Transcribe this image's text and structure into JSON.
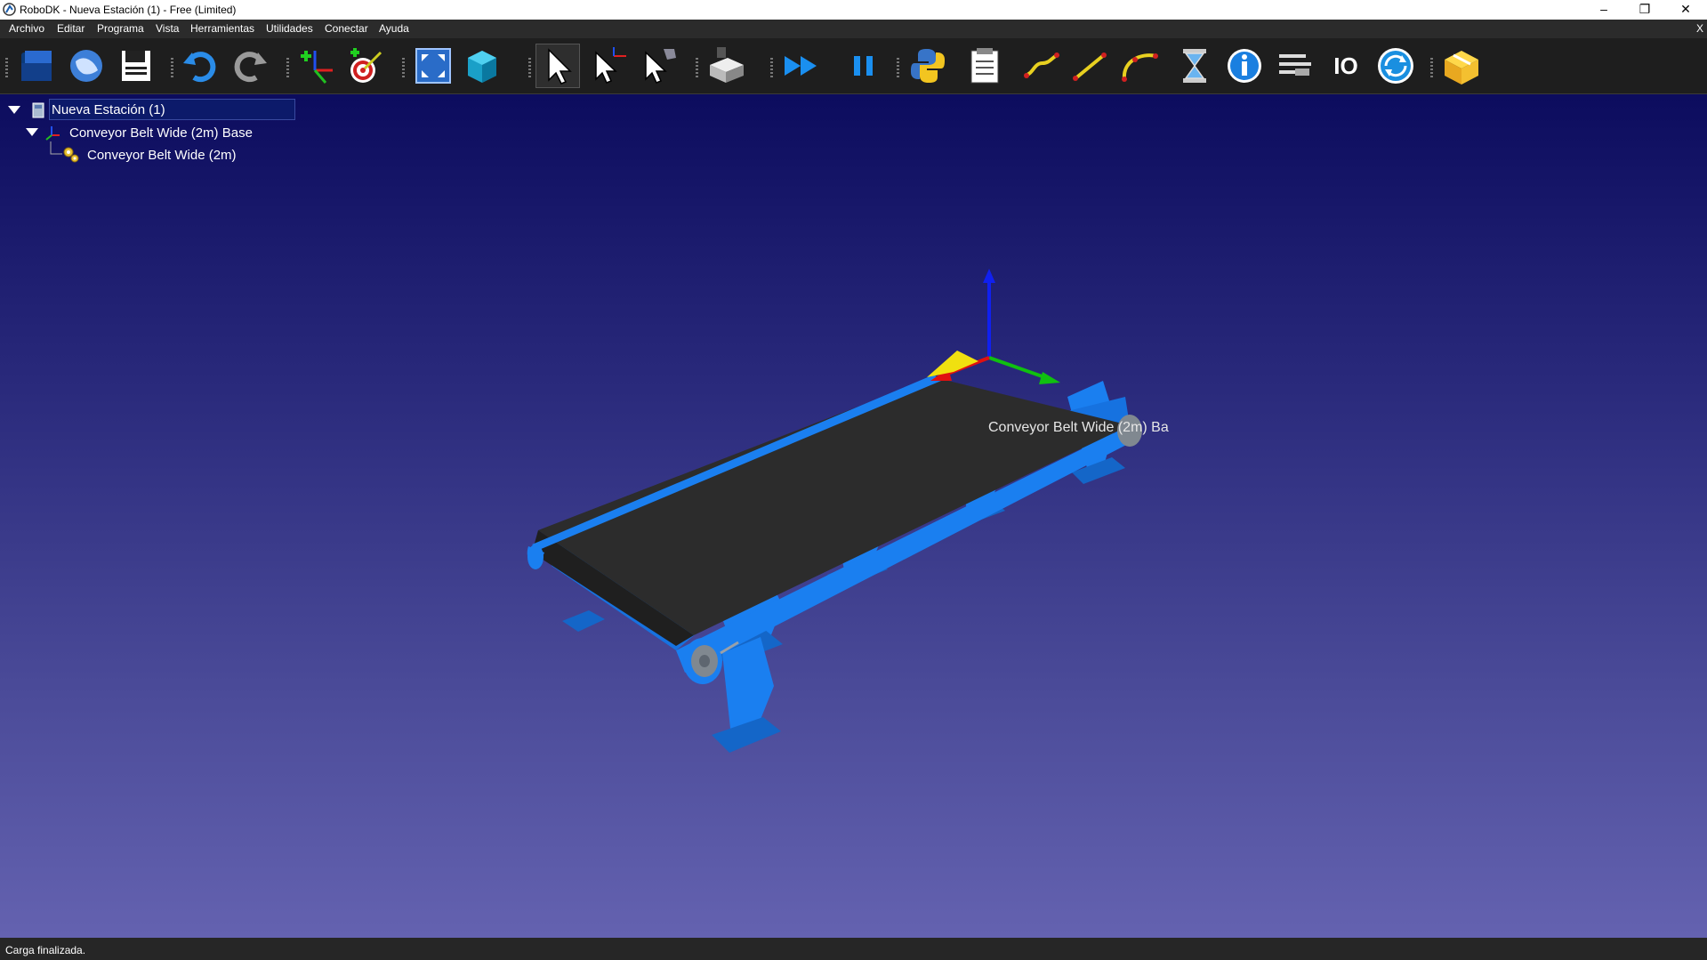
{
  "window": {
    "title": "RoboDK - Nueva Estación (1) - Free (Limited)",
    "controls": {
      "minimize": "–",
      "restore": "❐",
      "close": "✕"
    }
  },
  "menu": {
    "items": [
      "Archivo",
      "Editar",
      "Programa",
      "Vista",
      "Herramientas",
      "Utilidades",
      "Conectar",
      "Ayuda"
    ],
    "close_label": "X"
  },
  "toolbar": {
    "buttons": [
      "open-station-icon",
      "online-library-icon",
      "save-icon",
      "undo-icon",
      "redo-icon",
      "add-reference-frame-icon",
      "add-target-icon",
      "fit-all-icon",
      "view-box-icon",
      "select-icon",
      "move-reference-icon",
      "move-tool-icon",
      "tool-station-icon",
      "fast-simulation-icon",
      "pause-icon",
      "python-icon",
      "program-report-icon",
      "joint-move-icon",
      "linear-move-icon",
      "circular-move-icon",
      "pause-instruction-icon",
      "info-icon",
      "set-instruction-icon",
      "io-icon",
      "refresh-icon",
      "package-icon"
    ],
    "io_text": "IO"
  },
  "tree": {
    "root": "Nueva Estación (1)",
    "children": [
      {
        "label": "Conveyor Belt Wide (2m) Base"
      },
      {
        "label": "Conveyor Belt Wide (2m)"
      }
    ]
  },
  "viewport": {
    "object_label": "Conveyor Belt Wide (2m) Ba",
    "colors": {
      "conveyor": "#1a7ff0",
      "belt": "#2b2b2b",
      "axis_x": "#e01010",
      "axis_y": "#10c010",
      "axis_z": "#1020f0",
      "background_top": "#0c0c5e",
      "background_bottom": "#6462b0"
    }
  },
  "status": {
    "text": "Carga finalizada."
  }
}
